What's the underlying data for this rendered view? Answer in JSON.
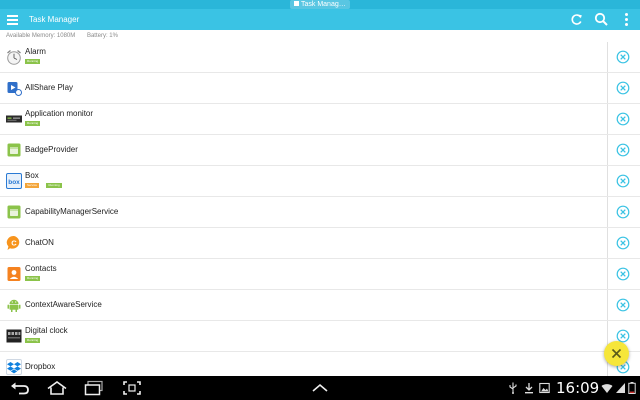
{
  "status_bar": {
    "notification": "Task Manag…",
    "colors": {
      "bar": "#2ab6d9"
    }
  },
  "app_bar": {
    "title": "Task Manager",
    "actions": [
      "refresh-icon",
      "search-icon",
      "overflow-menu-icon"
    ],
    "colors": {
      "background": "#3ac3e4",
      "foreground": "#ffffff"
    }
  },
  "info": {
    "memory": "Available Memory: 1080M",
    "battery": "Battery: 1%"
  },
  "list": {
    "items": [
      {
        "name": "Alarm",
        "icon": "alarm-clock-icon",
        "badges": [
          {
            "text": "Running",
            "color": "#8bc34a"
          }
        ]
      },
      {
        "name": "AllShare Play",
        "icon": "allshare-play-icon",
        "badges": []
      },
      {
        "name": "Application monitor",
        "icon": "application-monitor-icon",
        "badges": [
          {
            "text": "Running",
            "color": "#8bc34a"
          }
        ]
      },
      {
        "name": "BadgeProvider",
        "icon": "android-package-icon",
        "badges": []
      },
      {
        "name": "Box",
        "icon": "box-icon",
        "badges": [
          {
            "text": "Service",
            "color": "#f3a53a"
          },
          {
            "text": "Running",
            "color": "#8bc34a"
          }
        ]
      },
      {
        "name": "CapabilityManagerService",
        "icon": "android-package-icon",
        "badges": []
      },
      {
        "name": "ChatON",
        "icon": "chaton-icon",
        "badges": []
      },
      {
        "name": "Contacts",
        "icon": "contacts-icon",
        "badges": [
          {
            "text": "Running",
            "color": "#8bc34a"
          }
        ]
      },
      {
        "name": "ContextAwareService",
        "icon": "android-robot-icon",
        "badges": []
      },
      {
        "name": "Digital clock",
        "icon": "digital-clock-icon",
        "badges": [
          {
            "text": "Running",
            "color": "#8bc34a"
          }
        ]
      },
      {
        "name": "Dropbox",
        "icon": "dropbox-icon",
        "badges": []
      }
    ],
    "kill_icon": "close-circle-icon",
    "colors": {
      "kill": "#3ac3e4"
    }
  },
  "fab": {
    "icon": "close-icon",
    "color": "#f6e63a"
  },
  "nav_bar": {
    "buttons": [
      "back-icon",
      "home-icon",
      "recent-apps-icon",
      "screenshot-icon",
      "chevron-up-icon"
    ],
    "time": "16:09",
    "status_icons": [
      "usb-icon",
      "download-icon",
      "image-icon",
      "wifi-icon",
      "signal-icon",
      "battery-icon"
    ]
  }
}
